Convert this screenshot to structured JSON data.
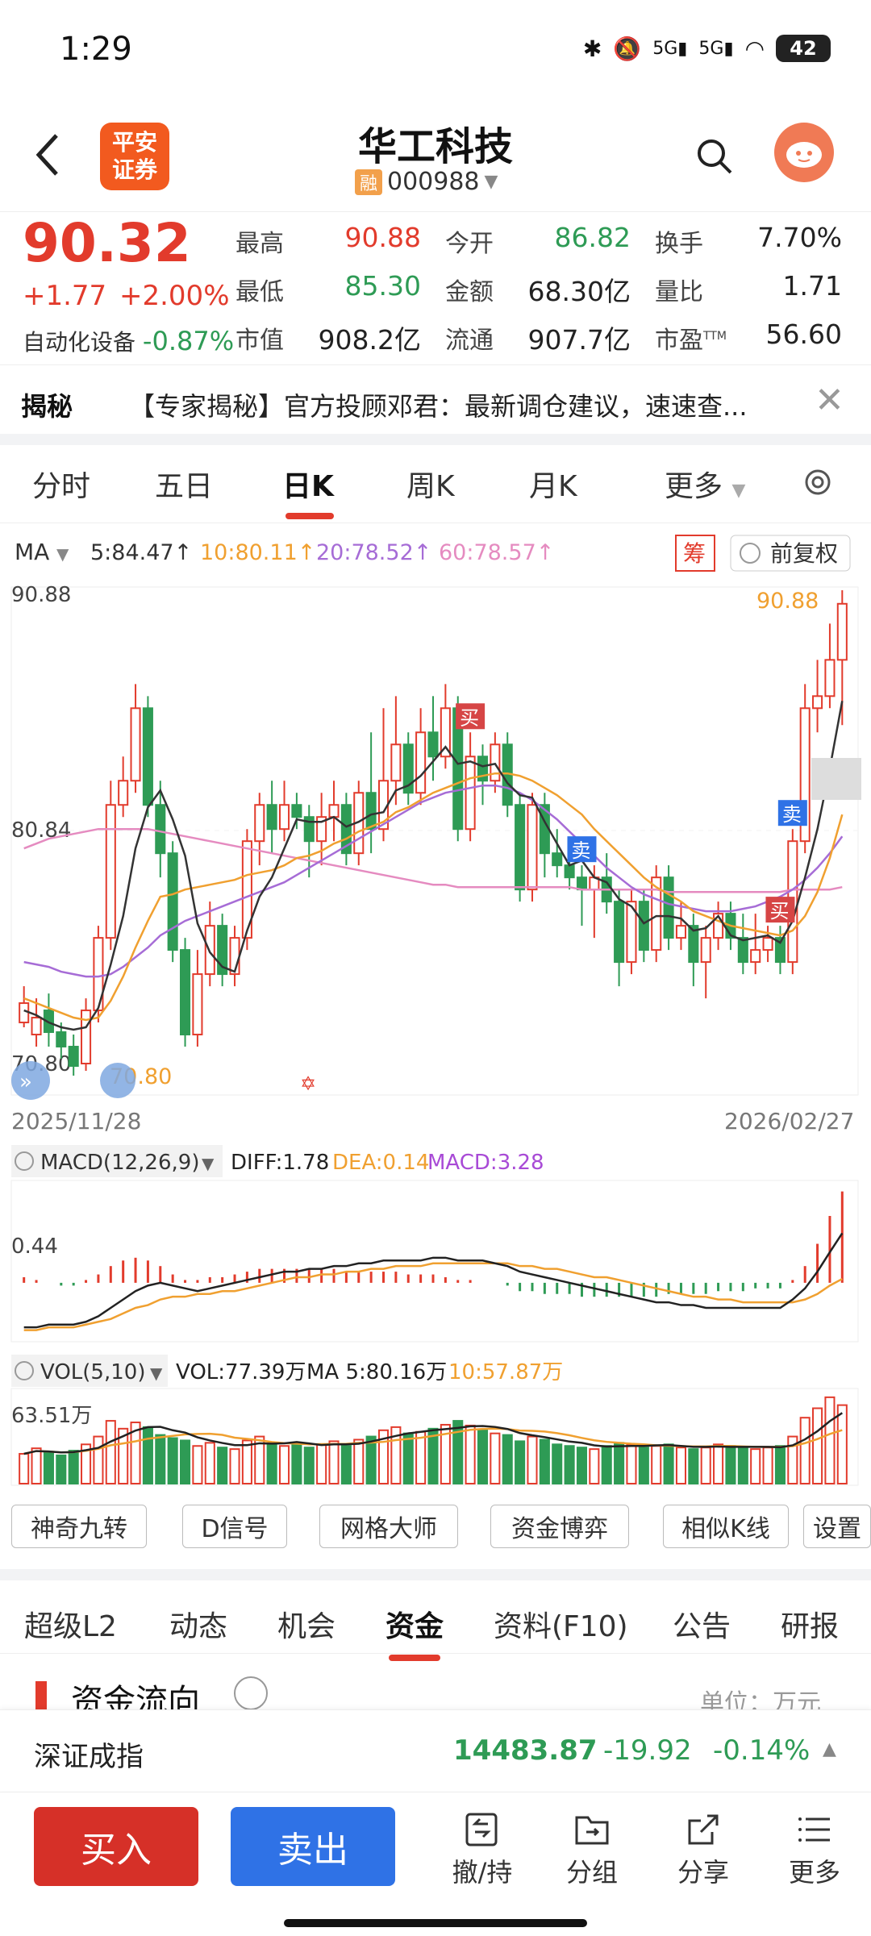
{
  "status": {
    "time": "1:29",
    "battery": "42",
    "signal_label": "5G"
  },
  "header": {
    "title": "华工科技",
    "margin_badge": "融",
    "code": "000988",
    "broker_logo": "平安\n证券",
    "broker_logo_line1": "平安",
    "broker_logo_line2": "证券"
  },
  "quote": {
    "price": "90.32",
    "change": "+1.77",
    "change_pct": "+2.00%",
    "sector": "自动化设备",
    "sector_change": "-0.87%",
    "stats": [
      {
        "label": "最高",
        "value": "90.88",
        "color": "red"
      },
      {
        "label": "今开",
        "value": "86.82",
        "color": "green"
      },
      {
        "label": "换手",
        "value": "7.70%",
        "color": "dark"
      },
      {
        "label": "最低",
        "value": "85.30",
        "color": "green"
      },
      {
        "label": "金额",
        "value": "68.30亿",
        "color": "dark"
      },
      {
        "label": "量比",
        "value": "1.71",
        "color": "dark"
      },
      {
        "label": "市值",
        "value": "908.2亿",
        "color": "dark"
      },
      {
        "label": "流通",
        "value": "907.7亿",
        "color": "dark"
      },
      {
        "label": "市盈",
        "value": "56.60",
        "color": "dark",
        "sup": "TTM"
      }
    ]
  },
  "banner": {
    "label": "揭秘",
    "text": "【专家揭秘】官方投顾邓君：最新调仓建议，速速查..."
  },
  "period_tabs": [
    "分时",
    "五日",
    "日K",
    "周K",
    "月K",
    "更多"
  ],
  "chart": {
    "ma_label": "MA",
    "ma5": "5:84.47↑",
    "ma10": "10:80.11↑",
    "ma20": "20:78.52↑",
    "ma60": "60:78.57↑",
    "chip_badge": "筹",
    "adjust_label": "前复权",
    "y_top": "90.88",
    "y_mid": "80.84",
    "y_bottom": "70.80",
    "high_label": "90.88",
    "low_label": "70.80",
    "date_start": "2025/11/28",
    "date_end": "2026/02/27",
    "macd_label": "MACD(12,26,9)",
    "diff": "DIFF:1.78",
    "dea": "DEA:0.14",
    "macd": "MACD:3.28",
    "macd_axis": "0.44",
    "vol_label": "VOL(5,10)",
    "vol": "VOL:77.39万",
    "vol_ma5": "MA 5:80.16万",
    "vol_ma10": "10:57.87万",
    "vol_axis": "63.51万",
    "marker_buy": "买",
    "marker_sell": "卖",
    "colors": {
      "up": "#e23b2c",
      "down": "#2e9b55",
      "ma5": "#333333",
      "ma10": "#f0a030",
      "ma20": "#a66cd6",
      "ma60": "#e58bc0"
    }
  },
  "chart_data": {
    "type": "candlestick",
    "ylim": [
      70.8,
      90.88
    ],
    "candles": [
      [
        73,
        73.8,
        72.8,
        74.5
      ],
      [
        72.5,
        73.2,
        72,
        74
      ],
      [
        73.5,
        72.6,
        72,
        74.2
      ],
      [
        72.6,
        72,
        71.5,
        73
      ],
      [
        72,
        71.2,
        70.8,
        72.5
      ],
      [
        71.3,
        73.5,
        71,
        74
      ],
      [
        73.5,
        76.5,
        73,
        77
      ],
      [
        76.5,
        82,
        76,
        83
      ],
      [
        82,
        83,
        81.5,
        84
      ],
      [
        83,
        86,
        82.5,
        87
      ],
      [
        86,
        82,
        81.5,
        86.5
      ],
      [
        82,
        80,
        79,
        83
      ],
      [
        80,
        76,
        75.5,
        80.5
      ],
      [
        76,
        72.5,
        72,
        76.5
      ],
      [
        72.5,
        75,
        72,
        76
      ],
      [
        75,
        77,
        74.5,
        78
      ],
      [
        77,
        75,
        74.5,
        77.5
      ],
      [
        75,
        76.5,
        74.5,
        77
      ],
      [
        76.5,
        80.5,
        76,
        81
      ],
      [
        80.5,
        82,
        79.5,
        82.5
      ],
      [
        82,
        81,
        80,
        83
      ],
      [
        81,
        82,
        80.5,
        83
      ],
      [
        82,
        81.5,
        81,
        82.5
      ],
      [
        81.5,
        80.5,
        79,
        82
      ],
      [
        80.5,
        81.5,
        79.5,
        82.5
      ],
      [
        81.5,
        82,
        80.5,
        83
      ],
      [
        82,
        80,
        79.5,
        82.5
      ],
      [
        80,
        82.5,
        79.5,
        83
      ],
      [
        82.5,
        81,
        80,
        85
      ],
      [
        81,
        83,
        80.5,
        86
      ],
      [
        83,
        84.5,
        82,
        86.5
      ],
      [
        84.5,
        82.5,
        82,
        85
      ],
      [
        82.5,
        85,
        82,
        86
      ],
      [
        85,
        84,
        83,
        86.5
      ],
      [
        84,
        86,
        83.5,
        87
      ],
      [
        86,
        81,
        80.5,
        86.5
      ],
      [
        81,
        84,
        80.5,
        85
      ],
      [
        84,
        83,
        82,
        84.5
      ],
      [
        83,
        84.5,
        82.5,
        85
      ],
      [
        84.5,
        82,
        81.5,
        85
      ],
      [
        82,
        78.5,
        78,
        82.5
      ],
      [
        78.5,
        82,
        78,
        82.5
      ],
      [
        82,
        80,
        79,
        82.5
      ],
      [
        80,
        79.5,
        79,
        81
      ],
      [
        79.5,
        79,
        78.5,
        80.5
      ],
      [
        79,
        78.5,
        77,
        79.5
      ],
      [
        78.5,
        79,
        76.5,
        79.5
      ],
      [
        79,
        78,
        77.5,
        80
      ],
      [
        78,
        75.5,
        74.5,
        78.5
      ],
      [
        75.5,
        78,
        75,
        78.5
      ],
      [
        78,
        76,
        75.5,
        78.5
      ],
      [
        76,
        79,
        75.5,
        79.5
      ],
      [
        79,
        76.5,
        76,
        79.5
      ],
      [
        76.5,
        77,
        76,
        78
      ],
      [
        77,
        75.5,
        74.5,
        77.5
      ],
      [
        75.5,
        76.5,
        74,
        77
      ],
      [
        76.5,
        77.5,
        76,
        78
      ],
      [
        77.5,
        76.5,
        76,
        78
      ],
      [
        76.5,
        75.5,
        75,
        77.5
      ],
      [
        75.5,
        76,
        75,
        77.5
      ],
      [
        76,
        76.5,
        75.5,
        77
      ],
      [
        76.5,
        75.5,
        75,
        77
      ],
      [
        75.5,
        80.5,
        75,
        81
      ],
      [
        80.5,
        86,
        80,
        87
      ],
      [
        86,
        86.5,
        85,
        88
      ],
      [
        86.5,
        88,
        86,
        89.5
      ],
      [
        88,
        90.32,
        85.3,
        90.88
      ]
    ],
    "ma5": [
      73.5,
      73.3,
      73,
      72.8,
      72.7,
      72.8,
      73.6,
      75.4,
      77.4,
      80.2,
      81.9,
      82.6,
      81.4,
      79.9,
      77.1,
      75.9,
      75.3,
      75.1,
      76.8,
      78.2,
      79,
      80.2,
      81.4,
      81.3,
      81.3,
      81.5,
      81.1,
      81.3,
      81.6,
      81.7,
      82.6,
      82.8,
      83.2,
      83.8,
      84.4,
      83.7,
      83.8,
      83.6,
      83.7,
      82.9,
      82.4,
      82.3,
      81.3,
      80.4,
      79.5,
      79.7,
      79,
      78.8,
      78.1,
      77.8,
      77.1,
      77.4,
      77.4,
      77.3,
      76.8,
      76.9,
      77.4,
      76.6,
      76.4,
      76.5,
      76.6,
      76.3,
      77.2,
      79,
      81,
      83.5,
      86.3
    ],
    "ma10": [
      74,
      73.8,
      73.6,
      73.4,
      73.2,
      73.1,
      73.2,
      73.9,
      74.9,
      76.1,
      77.2,
      78.2,
      78.3,
      78.5,
      78.6,
      78.7,
      78.8,
      78.9,
      79.1,
      79.2,
      79.3,
      79.5,
      79.8,
      79.9,
      80.1,
      80.4,
      80.6,
      80.9,
      81.1,
      81.3,
      81.7,
      81.9,
      82.2,
      82.5,
      82.7,
      82.9,
      83.1,
      83.2,
      83.3,
      83.3,
      83.2,
      83,
      82.7,
      82.4,
      82,
      81.6,
      81,
      80.5,
      80,
      79.5,
      79,
      78.6,
      78.3,
      78,
      77.6,
      77.4,
      77.2,
      77,
      76.9,
      76.8,
      76.7,
      76.6,
      76.8,
      77.4,
      78.4,
      79.8,
      81.6
    ],
    "ma20": [
      75.5,
      75.4,
      75.3,
      75.1,
      75,
      74.9,
      74.9,
      75,
      75.3,
      75.7,
      76.1,
      76.6,
      76.9,
      77.2,
      77.4,
      77.6,
      77.8,
      78,
      78.2,
      78.4,
      78.6,
      78.8,
      79.1,
      79.4,
      79.7,
      80,
      80.3,
      80.6,
      80.9,
      81.2,
      81.5,
      81.8,
      82.1,
      82.3,
      82.5,
      82.6,
      82.7,
      82.8,
      82.8,
      82.7,
      82.5,
      82.2,
      81.8,
      81.4,
      80.9,
      80.4,
      79.9,
      79.4,
      79,
      78.6,
      78.3,
      78.1,
      77.9,
      77.8,
      77.7,
      77.6,
      77.6,
      77.6,
      77.7,
      77.8,
      78,
      78.2,
      78.5,
      78.9,
      79.4,
      80,
      80.7
    ],
    "ma60": [
      80.2,
      80.4,
      80.6,
      80.7,
      80.8,
      80.9,
      81,
      81,
      81,
      81,
      81,
      80.9,
      80.8,
      80.7,
      80.6,
      80.5,
      80.4,
      80.3,
      80.2,
      80.1,
      80,
      79.9,
      79.8,
      79.7,
      79.6,
      79.5,
      79.4,
      79.3,
      79.2,
      79.1,
      79,
      78.9,
      78.8,
      78.7,
      78.7,
      78.6,
      78.6,
      78.6,
      78.6,
      78.6,
      78.6,
      78.6,
      78.6,
      78.6,
      78.6,
      78.5,
      78.5,
      78.5,
      78.5,
      78.5,
      78.5,
      78.5,
      78.4,
      78.4,
      78.4,
      78.4,
      78.4,
      78.4,
      78.4,
      78.4,
      78.4,
      78.4,
      78.5,
      78.5,
      78.5,
      78.5,
      78.6
    ],
    "volume": [
      38,
      45,
      40,
      36,
      42,
      50,
      60,
      80,
      70,
      78,
      72,
      62,
      58,
      55,
      48,
      52,
      46,
      44,
      55,
      60,
      50,
      48,
      52,
      46,
      50,
      54,
      48,
      56,
      60,
      68,
      72,
      64,
      66,
      70,
      75,
      80,
      74,
      68,
      64,
      62,
      54,
      60,
      56,
      50,
      48,
      46,
      44,
      48,
      52,
      50,
      46,
      48,
      50,
      46,
      44,
      46,
      50,
      48,
      46,
      44,
      46,
      48,
      60,
      84,
      96,
      110,
      100
    ],
    "macd": [
      0.2,
      0.1,
      0,
      -0.1,
      -0.1,
      0.1,
      0.3,
      0.6,
      0.8,
      0.9,
      0.8,
      0.6,
      0.3,
      0.1,
      0.1,
      0.2,
      0.2,
      0.3,
      0.4,
      0.5,
      0.5,
      0.5,
      0.5,
      0.5,
      0.5,
      0.5,
      0.4,
      0.4,
      0.4,
      0.4,
      0.4,
      0.3,
      0.3,
      0.3,
      0.2,
      0.1,
      0.1,
      0,
      0,
      -0.1,
      -0.3,
      -0.3,
      -0.4,
      -0.4,
      -0.4,
      -0.5,
      -0.5,
      -0.5,
      -0.5,
      -0.5,
      -0.5,
      -0.5,
      -0.4,
      -0.4,
      -0.4,
      -0.4,
      -0.3,
      -0.3,
      -0.3,
      -0.2,
      -0.2,
      -0.2,
      0.1,
      0.6,
      1.4,
      2.4,
      3.28
    ],
    "diff": [
      -1.6,
      -1.6,
      -1.5,
      -1.5,
      -1.5,
      -1.4,
      -1.2,
      -0.9,
      -0.6,
      -0.3,
      -0.1,
      0,
      -0.1,
      -0.2,
      -0.3,
      -0.2,
      -0.1,
      0,
      0.1,
      0.2,
      0.3,
      0.4,
      0.4,
      0.5,
      0.5,
      0.6,
      0.6,
      0.7,
      0.7,
      0.8,
      0.8,
      0.8,
      0.8,
      0.9,
      0.9,
      0.8,
      0.8,
      0.8,
      0.7,
      0.6,
      0.4,
      0.3,
      0.2,
      0.1,
      0,
      -0.1,
      -0.2,
      -0.3,
      -0.4,
      -0.5,
      -0.6,
      -0.7,
      -0.7,
      -0.8,
      -0.8,
      -0.9,
      -0.9,
      -0.9,
      -0.9,
      -0.9,
      -0.9,
      -0.9,
      -0.6,
      -0.2,
      0.4,
      1.1,
      1.78
    ],
    "dea": [
      -1.7,
      -1.7,
      -1.6,
      -1.6,
      -1.6,
      -1.5,
      -1.4,
      -1.3,
      -1.1,
      -0.9,
      -0.8,
      -0.6,
      -0.5,
      -0.5,
      -0.4,
      -0.4,
      -0.3,
      -0.3,
      -0.2,
      -0.1,
      0,
      0.1,
      0.2,
      0.2,
      0.3,
      0.3,
      0.4,
      0.4,
      0.5,
      0.5,
      0.6,
      0.6,
      0.6,
      0.7,
      0.7,
      0.7,
      0.7,
      0.7,
      0.7,
      0.7,
      0.6,
      0.6,
      0.5,
      0.5,
      0.4,
      0.3,
      0.2,
      0.2,
      0.1,
      0,
      -0.1,
      -0.2,
      -0.3,
      -0.4,
      -0.5,
      -0.5,
      -0.6,
      -0.6,
      -0.7,
      -0.7,
      -0.7,
      -0.7,
      -0.7,
      -0.6,
      -0.4,
      -0.1,
      0.14
    ],
    "buy_markers": [
      36,
      61
    ],
    "sell_markers": [
      45,
      62
    ]
  },
  "chart_tools": [
    "神奇九转",
    "D信号",
    "网格大师",
    "资金博弈",
    "相似K线",
    "设置"
  ],
  "lower_tabs": [
    "超级L2",
    "动态",
    "机会",
    "资金",
    "资料(F10)",
    "公告",
    "研报"
  ],
  "fund": {
    "title": "资金流向",
    "unit": "单位：万元"
  },
  "index_bar": {
    "name": "深证成指",
    "value": "14483.87",
    "change": "-19.92",
    "pct": "-0.14%"
  },
  "bottom": {
    "buy": "买入",
    "sell": "卖出",
    "icons": [
      "撤/持",
      "分组",
      "分享",
      "更多"
    ]
  }
}
